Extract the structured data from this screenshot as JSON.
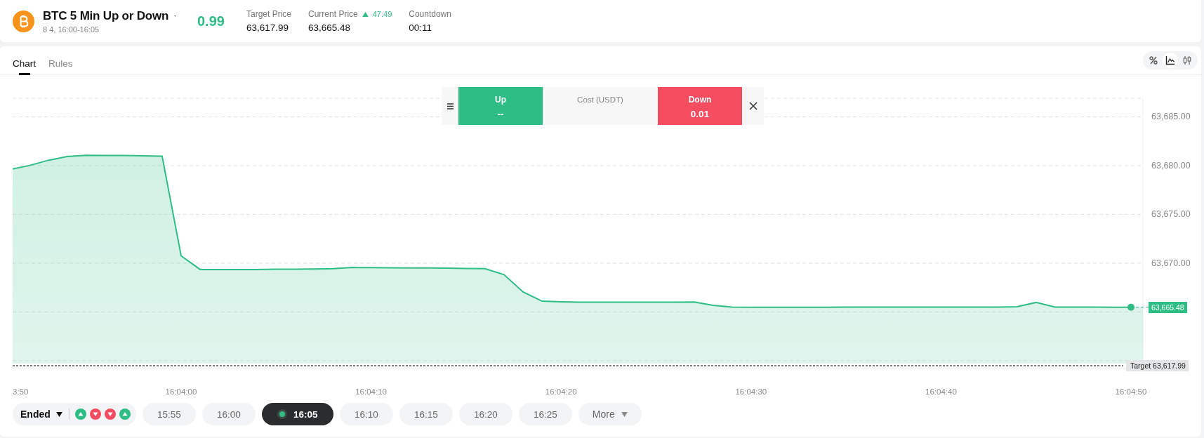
{
  "header": {
    "title": "BTC 5 Min Up or Down",
    "subtitle": "8 4, 16:00-16:05",
    "price": "0.99",
    "stats": [
      {
        "label": "Target Price",
        "value": "63,617.99"
      },
      {
        "label": "Current Price",
        "change": "47.49",
        "kind": "up",
        "value": "63,665.48"
      },
      {
        "label": "Countdown",
        "value": "00:11"
      }
    ]
  },
  "tabs": [
    {
      "label": "Chart",
      "selected": true
    },
    {
      "label": "Rules",
      "selected": false
    }
  ],
  "chart_modes": [
    {
      "kind": "percent",
      "selected": false
    },
    {
      "kind": "line",
      "selected": true
    },
    {
      "kind": "candles",
      "selected": false
    }
  ],
  "trade_panel": {
    "up": {
      "label": "Up",
      "value": "--"
    },
    "cost_label": "Cost (USDT)",
    "down": {
      "label": "Down",
      "value": "0.01"
    }
  },
  "chart": {
    "edge_label": "3:50",
    "price_tag": "63,665.48",
    "target_tag": "Target 63,617.99",
    "chart_data": {
      "type": "area",
      "grid": true,
      "categories": [
        null,
        null,
        null,
        null,
        null,
        null,
        null,
        null,
        null,
        null,
        "16:04:00",
        null,
        null,
        null,
        null,
        null,
        null,
        null,
        null,
        null,
        "16:04:10",
        null,
        null,
        null,
        null,
        null,
        null,
        null,
        null,
        null,
        "16:04:20",
        null,
        null,
        null,
        null,
        null,
        null,
        null,
        null,
        null,
        "16:04:30",
        null,
        null,
        null,
        null,
        null,
        null,
        null,
        null,
        null,
        "16:04:40",
        null,
        null,
        null,
        null,
        null,
        null,
        null,
        null,
        null,
        "16:04:50"
      ],
      "series": [
        {
          "color": "#2ebd85",
          "values": [
            null,
            63679.6,
            63680.0,
            63680.54,
            63680.93,
            63681.05,
            63681.04,
            63681.03,
            63681.0,
            63680.97,
            63670.75,
            63669.35,
            63669.35,
            63669.35,
            63669.35,
            63669.37,
            63669.39,
            63669.4,
            63669.44,
            63669.55,
            63669.54,
            63669.53,
            63669.51,
            63669.5,
            63669.48,
            63669.46,
            63669.43,
            63668.82,
            63667.04,
            63666.1,
            63666.04,
            63666.0,
            63666.0,
            63666.0,
            63666.0,
            63666.0,
            63666.0,
            63666.01,
            63665.68,
            63665.49,
            63665.48,
            63665.48,
            63665.48,
            63665.48,
            63665.48,
            63665.49,
            63665.49,
            63665.49,
            63665.49,
            63665.5,
            63665.5,
            63665.5,
            63665.5,
            63665.5,
            63665.54,
            63665.97,
            63665.5,
            63665.49,
            63665.49,
            63665.48,
            63665.48
          ]
        }
      ],
      "ylim": [
        63659.2,
        63686.9
      ],
      "yticks": [
        {
          "value": 63670,
          "label": "63,670.00"
        },
        {
          "value": 63675,
          "label": "63,675.00"
        },
        {
          "value": 63680,
          "label": "63,680.00"
        },
        {
          "value": 63685,
          "label": "63,685.00"
        }
      ]
    }
  },
  "rounds": {
    "status": "Ended",
    "history": [
      {
        "kind": "up"
      },
      {
        "kind": "down"
      },
      {
        "kind": "down"
      },
      {
        "kind": "up"
      }
    ],
    "slots": [
      {
        "label": "15:55",
        "selected": false
      },
      {
        "label": "16:00",
        "selected": false
      },
      {
        "label": "16:05",
        "selected": true
      },
      {
        "label": "16:10",
        "selected": false
      },
      {
        "label": "16:15",
        "selected": false
      },
      {
        "label": "16:20",
        "selected": false
      },
      {
        "label": "16:25",
        "selected": false
      },
      {
        "label": "More",
        "kind": "more",
        "selected": false
      }
    ]
  }
}
